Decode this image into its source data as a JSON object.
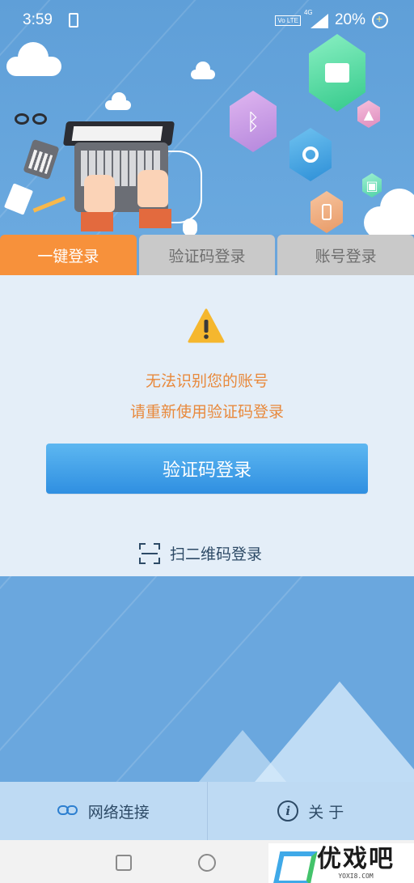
{
  "status_bar": {
    "time": "3:59",
    "volte": "Vo LTE",
    "network": "4G",
    "battery": "20%"
  },
  "tabs": [
    {
      "label": "一键登录",
      "active": true
    },
    {
      "label": "验证码登录",
      "active": false
    },
    {
      "label": "账号登录",
      "active": false
    }
  ],
  "message": {
    "line1": "无法识别您的账号",
    "line2": "请重新使用验证码登录",
    "icon": "warning-icon"
  },
  "verify_button_label": "验证码登录",
  "qr_login_label": "扫二维码登录",
  "bottom_bar": {
    "network_label": "网络连接",
    "about_label": "关 于"
  },
  "watermark": {
    "main": "优戏吧",
    "sub": "YOXI8.COM"
  },
  "colors": {
    "accent_orange": "#f7913b",
    "button_blue": "#2f8fe1",
    "message_orange": "#e8893c"
  }
}
